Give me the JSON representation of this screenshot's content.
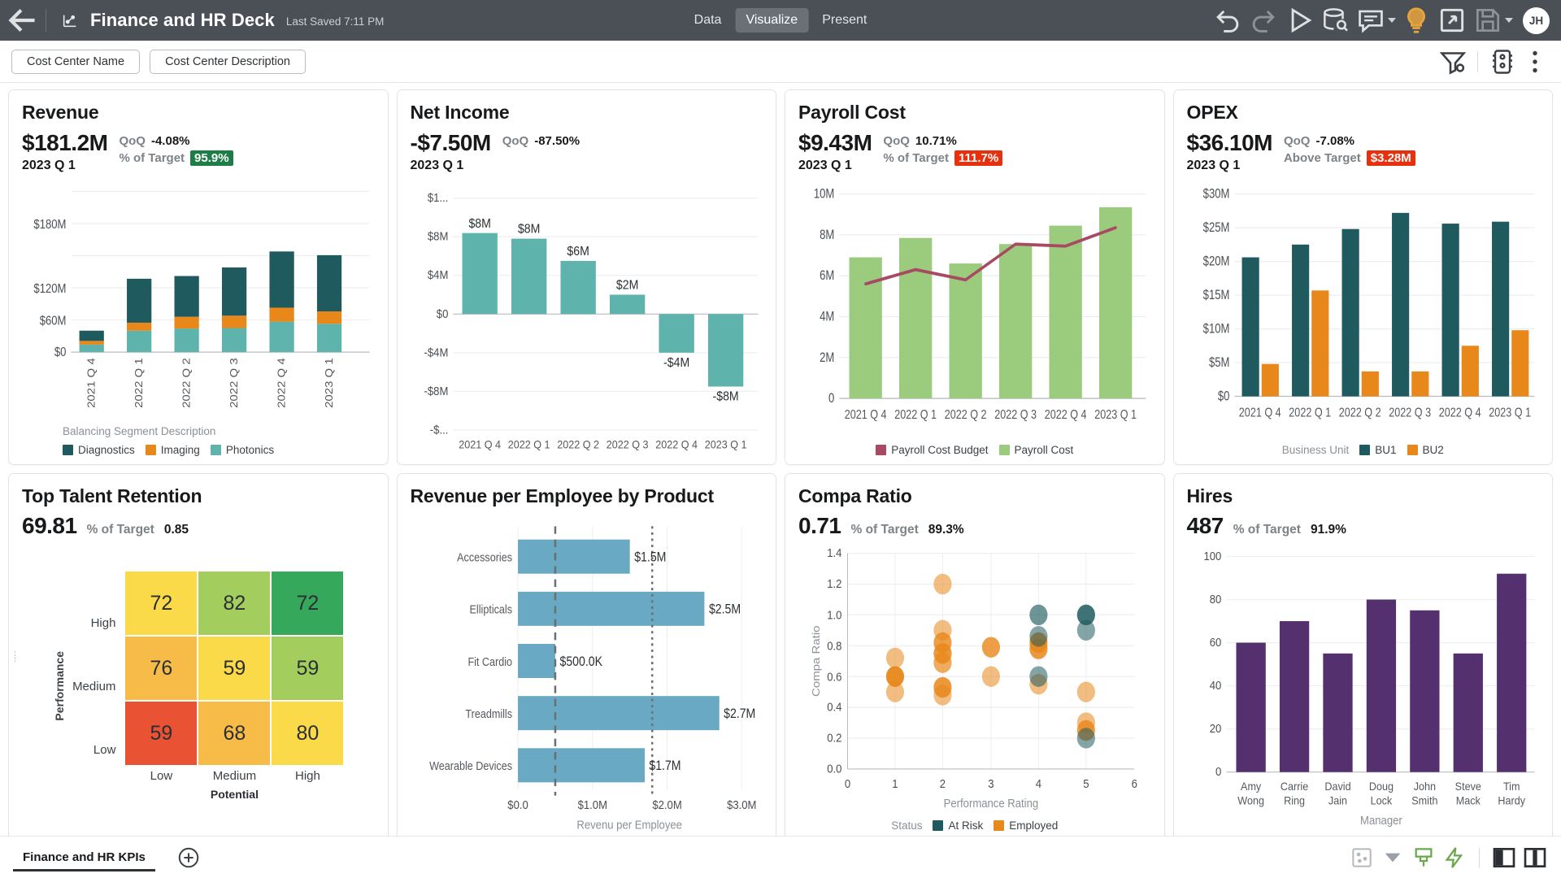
{
  "header": {
    "back_icon": "arrow-left-icon",
    "deck_icon": "chart-logo-icon",
    "title": "Finance and HR Deck",
    "last_saved": "Last Saved 7:11 PM",
    "tabs": [
      {
        "label": "Data",
        "active": false
      },
      {
        "label": "Visualize",
        "active": true
      },
      {
        "label": "Present",
        "active": false
      }
    ],
    "actions": [
      {
        "name": "undo-icon",
        "enabled": true
      },
      {
        "name": "redo-icon",
        "enabled": false
      },
      {
        "name": "play-icon",
        "enabled": true
      },
      {
        "name": "data-source-icon",
        "enabled": true
      },
      {
        "name": "comment-icon",
        "enabled": true,
        "caret": true
      },
      {
        "name": "lightbulb-icon",
        "enabled": true,
        "color": "#e8a33d"
      },
      {
        "name": "share-export-icon",
        "enabled": true
      },
      {
        "name": "save-icon",
        "enabled": false,
        "caret": true
      }
    ],
    "avatar_initials": "JH"
  },
  "filter_bar": {
    "chips": [
      "Cost Center Name",
      "Cost Center Description"
    ],
    "icons": [
      "filter-settings-icon",
      "board-settings-icon",
      "more-options-icon"
    ]
  },
  "cards": [
    {
      "id": "revenue",
      "title": "Revenue",
      "value": "$181.2M",
      "period": "2023 Q 1",
      "metrics": [
        {
          "label": "QoQ",
          "value": "-4.08%",
          "badge": null
        },
        {
          "label": "% of Target",
          "value": "95.9%",
          "badge": "green"
        }
      ]
    },
    {
      "id": "net-income",
      "title": "Net Income",
      "value": "-$7.50M",
      "period": "2023 Q 1",
      "metrics": [
        {
          "label": "QoQ",
          "value": "-87.50%",
          "badge": null
        }
      ]
    },
    {
      "id": "payroll-cost",
      "title": "Payroll Cost",
      "value": "$9.43M",
      "period": "2023 Q 1",
      "metrics": [
        {
          "label": "QoQ",
          "value": "10.71%",
          "badge": null
        },
        {
          "label": "% of Target",
          "value": "111.7%",
          "badge": "red"
        }
      ]
    },
    {
      "id": "opex",
      "title": "OPEX",
      "value": "$36.10M",
      "period": "2023 Q 1",
      "metrics": [
        {
          "label": "QoQ",
          "value": "-7.08%",
          "badge": null
        },
        {
          "label": "Above Target",
          "value": "$3.28M",
          "badge": "red"
        }
      ]
    },
    {
      "id": "top-talent-retention",
      "title": "Top Talent Retention",
      "value": "69.81",
      "metrics": [
        {
          "label": "% of Target",
          "value": "0.85",
          "badge": null
        }
      ]
    },
    {
      "id": "revenue-per-employee",
      "title": "Revenue per Employee by Product",
      "value": "",
      "metrics": []
    },
    {
      "id": "compa-ratio",
      "title": "Compa Ratio",
      "value": "0.71",
      "metrics": [
        {
          "label": "% of Target",
          "value": "89.3%",
          "badge": null
        }
      ]
    },
    {
      "id": "hires",
      "title": "Hires",
      "value": "487",
      "metrics": [
        {
          "label": "% of Target",
          "value": "91.9%",
          "badge": null
        }
      ]
    }
  ],
  "chart_data": [
    {
      "id": "revenue",
      "type": "bar",
      "stacked": true,
      "title": "Revenue",
      "categories": [
        "2021 Q 4",
        "2022 Q 1",
        "2022 Q 2",
        "2022 Q 3",
        "2022 Q 4",
        "2023 Q 1"
      ],
      "series": [
        {
          "name": "Photonics",
          "color": "#5eb3ac",
          "values": [
            14,
            40,
            44,
            45,
            57,
            53
          ]
        },
        {
          "name": "Imaging",
          "color": "#e8871a",
          "values": [
            7,
            15,
            22,
            23,
            26,
            23
          ]
        },
        {
          "name": "Diagnostics",
          "color": "#1f5a5e",
          "values": [
            19,
            82,
            76,
            90,
            105,
            105
          ]
        }
      ],
      "ylabel": "",
      "ytick_labels": [
        "$0",
        "$60M",
        "$120M",
        "$180M"
      ],
      "ytick_values": [
        0,
        60,
        120,
        180
      ],
      "ylim": [
        0,
        200
      ],
      "legend_title": "Balancing Segment Description",
      "legend_position": "bottom",
      "grid": true
    },
    {
      "id": "net-income",
      "type": "bar",
      "title": "Net Income",
      "categories": [
        "2021 Q 4",
        "2022 Q 1",
        "2022 Q 2",
        "2022 Q 3",
        "2022 Q 4",
        "2023 Q 1"
      ],
      "values": [
        8.4,
        7.8,
        5.5,
        2.0,
        -4.0,
        -7.5
      ],
      "data_labels": [
        "$8M",
        "$8M",
        "$6M",
        "$2M",
        "-$4M",
        "-$8M"
      ],
      "color": "#5eb3ac",
      "ytick_labels": [
        "$1...",
        "$8M",
        "$4M",
        "$0",
        "-$4M",
        "-$8M",
        "-$..."
      ],
      "ytick_values": [
        12,
        8,
        4,
        0,
        -4,
        -8,
        -12
      ],
      "ylim": [
        -12,
        12
      ],
      "grid": true
    },
    {
      "id": "payroll-cost",
      "type": "bar",
      "title": "Payroll Cost",
      "categories": [
        "2021 Q 4",
        "2022 Q 1",
        "2022 Q 2",
        "2022 Q 3",
        "2022 Q 4",
        "2023 Q 1"
      ],
      "series": [
        {
          "name": "Payroll Cost",
          "kind": "bar",
          "color": "#9bcb7d",
          "values": [
            6.9,
            7.85,
            6.6,
            7.55,
            8.45,
            9.35
          ]
        },
        {
          "name": "Payroll Cost Budget",
          "kind": "line",
          "color": "#a84a63",
          "values": [
            5.6,
            6.3,
            5.8,
            7.55,
            7.45,
            8.35
          ]
        }
      ],
      "ytick_labels": [
        "0",
        "2M",
        "4M",
        "6M",
        "8M",
        "10M"
      ],
      "ytick_values": [
        0,
        2,
        4,
        6,
        8,
        10
      ],
      "ylim": [
        0,
        10.6
      ],
      "legend_position": "bottom",
      "grid": true
    },
    {
      "id": "opex",
      "type": "bar",
      "title": "OPEX",
      "categories": [
        "2021 Q 4",
        "2022 Q 1",
        "2022 Q 2",
        "2022 Q 3",
        "2022 Q 4",
        "2023 Q 1"
      ],
      "series": [
        {
          "name": "BU1",
          "color": "#1f5a5e",
          "values": [
            20.6,
            22.5,
            24.8,
            27.2,
            25.6,
            25.9
          ]
        },
        {
          "name": "BU2",
          "color": "#e8871a",
          "values": [
            4.8,
            15.7,
            3.7,
            3.7,
            7.5,
            9.8
          ]
        }
      ],
      "ytick_labels": [
        "$0",
        "$5M",
        "$10M",
        "$15M",
        "$20M",
        "$25M",
        "$30M"
      ],
      "ytick_values": [
        0,
        5,
        10,
        15,
        20,
        25,
        30
      ],
      "ylim": [
        0,
        31
      ],
      "legend_title": "Business Unit",
      "legend_position": "bottom",
      "grid": true
    },
    {
      "id": "top-talent-retention",
      "type": "heatmap",
      "title": "Top Talent Retention",
      "xlabel": "Potential",
      "ylabel": "Performance",
      "x_categories": [
        "Low",
        "Medium",
        "High"
      ],
      "y_categories": [
        "High",
        "Medium",
        "Low"
      ],
      "cells": [
        [
          {
            "value": 72,
            "color": "#fada48"
          },
          {
            "value": 82,
            "color": "#a3ce5e"
          },
          {
            "value": 72,
            "color": "#36a85c"
          }
        ],
        [
          {
            "value": 76,
            "color": "#f7bc48"
          },
          {
            "value": 59,
            "color": "#fada48"
          },
          {
            "value": 59,
            "color": "#a3ce5e"
          }
        ],
        [
          {
            "value": 59,
            "color": "#ea5234"
          },
          {
            "value": 68,
            "color": "#f7bc48"
          },
          {
            "value": 80,
            "color": "#fada48"
          }
        ]
      ]
    },
    {
      "id": "revenue-per-employee",
      "type": "bar",
      "orientation": "horizontal",
      "title": "Revenue per Employee by Product",
      "categories": [
        "Accessories",
        "Ellipticals",
        "Fit Cardio",
        "Treadmills",
        "Wearable Devices"
      ],
      "values": [
        1.5,
        2.5,
        0.5,
        2.7,
        1.7
      ],
      "data_labels": [
        "$1.5M",
        "$2.5M",
        "$500.0K",
        "$2.7M",
        "$1.7M"
      ],
      "color": "#6aa9c4",
      "xtick_labels": [
        "$0.0",
        "$1.0M",
        "$2.0M",
        "$3.0M"
      ],
      "xtick_values": [
        0,
        1,
        2,
        3
      ],
      "xlim": [
        0,
        3.3
      ],
      "xlabel": "Revenu per Employee",
      "reference_lines": [
        {
          "value": 0.5,
          "style": "dashed"
        },
        {
          "value": 1.8,
          "style": "dotted"
        }
      ]
    },
    {
      "id": "compa-ratio",
      "type": "scatter",
      "title": "Compa Ratio",
      "xlabel": "Performance Rating",
      "ylabel": "Compa Ratio",
      "xlim": [
        0,
        6
      ],
      "ylim": [
        0,
        1.4
      ],
      "xtick_labels": [
        "0",
        "1",
        "2",
        "3",
        "4",
        "5",
        "6"
      ],
      "ytick_labels": [
        "0.0",
        "0.2",
        "0.4",
        "0.6",
        "0.8",
        "1.0",
        "1.2",
        "1.4"
      ],
      "legend_title": "Status",
      "series": [
        {
          "name": "At Risk",
          "color": "#1f5a5e",
          "points": [
            [
              5,
              1.0
            ],
            [
              5,
              0.9
            ],
            [
              4,
              0.86
            ],
            [
              4,
              0.6
            ],
            [
              4,
              1.0
            ],
            [
              5,
              0.2
            ]
          ]
        },
        {
          "name": "Employed",
          "color": "#e8871a",
          "points": [
            [
              1,
              0.72
            ],
            [
              1,
              0.6
            ],
            [
              1,
              0.5
            ],
            [
              2,
              1.2
            ],
            [
              2,
              0.9
            ],
            [
              2,
              0.82
            ],
            [
              2,
              0.75
            ],
            [
              2,
              0.69
            ],
            [
              2,
              0.53
            ],
            [
              2,
              0.48
            ],
            [
              3,
              0.79
            ],
            [
              3,
              0.6
            ],
            [
              4,
              0.82
            ],
            [
              4,
              0.78
            ],
            [
              4,
              0.55
            ],
            [
              5,
              0.5
            ],
            [
              5,
              0.3
            ],
            [
              5,
              0.25
            ]
          ]
        }
      ]
    },
    {
      "id": "hires",
      "type": "bar",
      "title": "Hires",
      "categories": [
        "Amy Wong",
        "Carrie Ring",
        "David Jain",
        "Doug Lock",
        "John Smith",
        "Steve Mack",
        "Tim Hardy"
      ],
      "values": [
        60,
        70,
        55,
        80,
        75,
        55,
        92
      ],
      "color": "#55306e",
      "ytick_labels": [
        "0",
        "20",
        "40",
        "60",
        "80",
        "100"
      ],
      "ytick_values": [
        0,
        20,
        40,
        60,
        80,
        100
      ],
      "ylim": [
        0,
        104
      ],
      "xlabel": "Manager",
      "grid": true
    }
  ],
  "bottom_bar": {
    "sheet_tab": "Finance and HR KPIs",
    "add_icon": "add-sheet-icon",
    "icons": [
      "layout-grid-icon",
      "caret-down-icon",
      "paint-brush-icon",
      "lightning-icon",
      "panel-left-icon",
      "panel-right-icon"
    ]
  }
}
